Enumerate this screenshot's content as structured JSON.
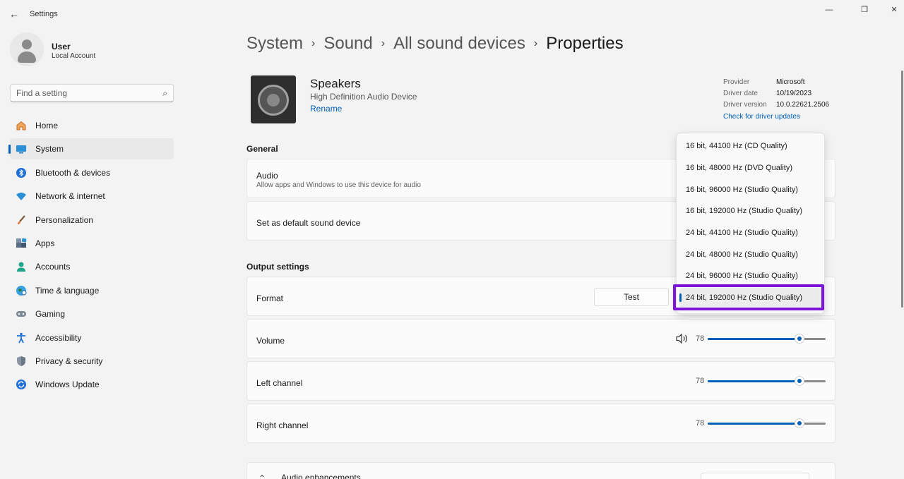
{
  "window": {
    "title": "Settings",
    "back_icon": "←",
    "minimize": "—",
    "maximize": "❐",
    "close": "✕"
  },
  "user": {
    "name": "User",
    "account": "Local Account"
  },
  "search": {
    "placeholder": "Find a setting",
    "icon": "⌕"
  },
  "sidebar": {
    "items": [
      {
        "label": "Home",
        "icon": "home-icon"
      },
      {
        "label": "System",
        "icon": "system-icon",
        "active": true
      },
      {
        "label": "Bluetooth & devices",
        "icon": "bluetooth-icon"
      },
      {
        "label": "Network & internet",
        "icon": "wifi-icon"
      },
      {
        "label": "Personalization",
        "icon": "brush-icon"
      },
      {
        "label": "Apps",
        "icon": "apps-icon"
      },
      {
        "label": "Accounts",
        "icon": "accounts-icon"
      },
      {
        "label": "Time & language",
        "icon": "globe-icon"
      },
      {
        "label": "Gaming",
        "icon": "gamepad-icon"
      },
      {
        "label": "Accessibility",
        "icon": "accessibility-icon"
      },
      {
        "label": "Privacy & security",
        "icon": "shield-icon"
      },
      {
        "label": "Windows Update",
        "icon": "update-icon"
      }
    ]
  },
  "breadcrumb": {
    "items": [
      "System",
      "Sound",
      "All sound devices"
    ],
    "separator": "›",
    "current": "Properties"
  },
  "device": {
    "name": "Speakers",
    "description": "High Definition Audio Device",
    "rename": "Rename"
  },
  "driver_info": {
    "provider_label": "Provider",
    "provider": "Microsoft",
    "date_label": "Driver date",
    "date": "10/19/2023",
    "version_label": "Driver version",
    "version": "10.0.22621.2506",
    "check_updates": "Check for driver updates"
  },
  "general": {
    "title": "General",
    "audio_title": "Audio",
    "audio_sub": "Allow apps and Windows to use this device for audio",
    "default_title": "Set as default sound device"
  },
  "output": {
    "title": "Output settings",
    "format_label": "Format",
    "test_label": "Test",
    "volume_label": "Volume",
    "volume_value": "78",
    "left_label": "Left channel",
    "left_value": "78",
    "right_label": "Right channel",
    "right_value": "78",
    "speaker_icon": "🔈"
  },
  "format_dropdown": {
    "options": [
      "16 bit, 44100 Hz (CD Quality)",
      "16 bit, 48000 Hz (DVD Quality)",
      "16 bit, 96000 Hz (Studio Quality)",
      "16 bit, 192000 Hz (Studio Quality)",
      "24 bit, 44100 Hz (Studio Quality)",
      "24 bit, 48000 Hz (Studio Quality)",
      "24 bit, 96000 Hz (Studio Quality)",
      "24 bit, 192000 Hz (Studio Quality)"
    ],
    "selected_index": 7
  },
  "enhancements": {
    "title": "Audio enhancements",
    "icon": "⌃"
  },
  "colors": {
    "accent": "#005fb8",
    "highlight": "#7b16d8"
  }
}
